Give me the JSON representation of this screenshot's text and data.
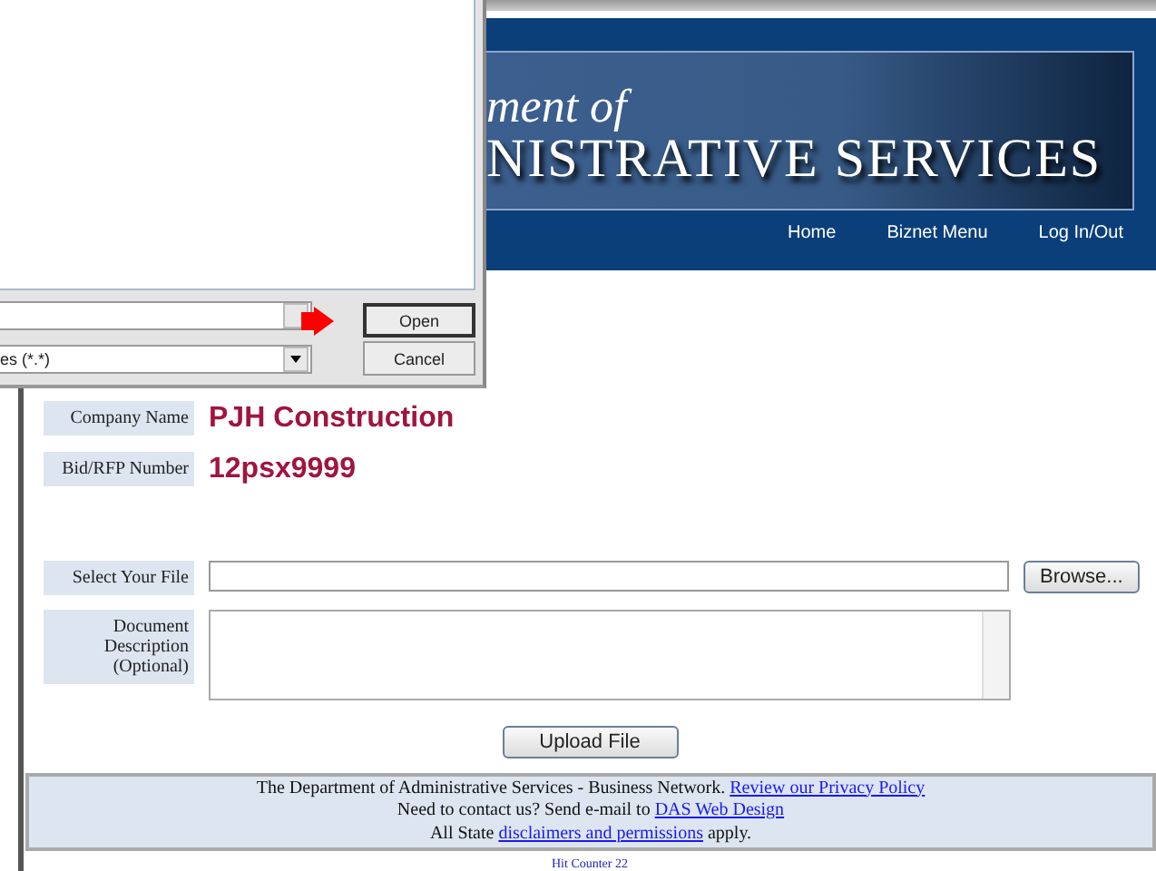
{
  "dialog": {
    "file_type": "es (*.*)",
    "buttons": [
      {
        "label": "Open",
        "default": true
      },
      {
        "label": "Cancel",
        "default": false
      }
    ]
  },
  "banner": {
    "line_1": "ment of",
    "line_2": "NISTRATIVE SERVICES"
  },
  "nav": [
    "Home",
    "Biznet Menu",
    "Log In/Out"
  ],
  "info": [
    {
      "label": "Company Name",
      "value": "PJH Construction"
    },
    {
      "label": "Bid/RFP Number",
      "value": "12psx9999"
    }
  ],
  "upload": {
    "file_label": "Select Your File",
    "browse": "Browse...",
    "description_label": "Document Description (Optional)",
    "submit": "Upload File"
  },
  "footer": {
    "lines": [
      [
        {
          "kind": "text",
          "text": "The Department of Administrative Services - Business Network. "
        },
        {
          "kind": "link",
          "text": "Review our Privacy Policy"
        }
      ],
      [
        {
          "kind": "text",
          "text": "Need to contact us? Send e-mail to "
        },
        {
          "kind": "link",
          "text": "DAS Web Design"
        }
      ],
      [
        {
          "kind": "text",
          "text": "All State "
        },
        {
          "kind": "link",
          "text": "disclaimers and permissions"
        },
        {
          "kind": "text",
          "text": " apply."
        }
      ]
    ],
    "hit_counter": "Hit Counter 22"
  }
}
